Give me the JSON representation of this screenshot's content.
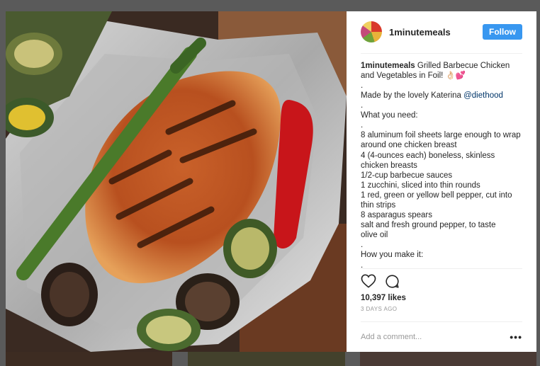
{
  "post": {
    "username": "1minutemeals",
    "follow_label": "Follow",
    "caption": {
      "author": "1minutemeals",
      "title_text": " Grilled Barbecue Chicken and Vegetables in Foil! 👌🏻💕",
      "made_by_prefix": "Made by the lovely Katerina ",
      "mention": "@diethood",
      "lines": [
        ".",
        "__MADEBY__",
        ".",
        "What you need:",
        ".",
        "8 aluminum foil sheets large enough to wrap around one chicken breast",
        "4 (4-ounces each) boneless, skinless chicken breasts",
        "1/2-cup barbecue sauces",
        "1 zucchini, sliced into thin rounds",
        "1 red, green or yellow bell pepper, cut into thin strips",
        "8 asparagus spears",
        "salt and fresh ground pepper, to taste",
        "olive oil",
        ".",
        "How you make it:",
        "."
      ]
    },
    "likes": "10,397 likes",
    "date": "3 DAYS AGO",
    "comment_placeholder": "Add a comment...",
    "more_label": "•••",
    "icons": [
      "heart-icon",
      "comment-icon",
      "more-options-icon"
    ],
    "colors": {
      "follow": "#3897f0",
      "mention": "#003569"
    }
  }
}
